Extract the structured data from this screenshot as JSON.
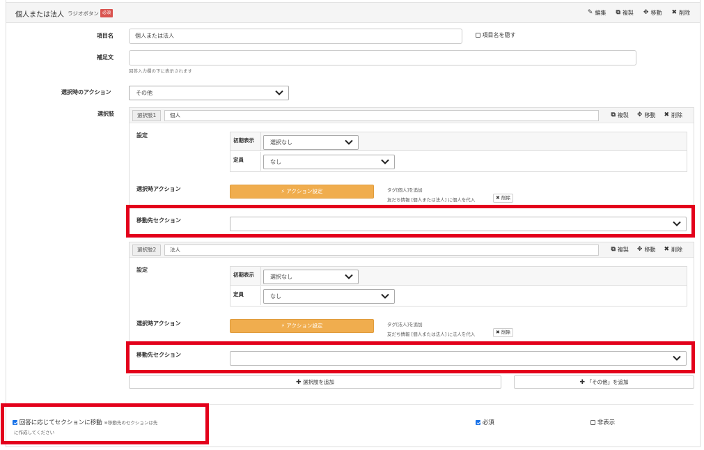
{
  "header": {
    "title": "個人または法人",
    "subtitle": "ラジオボタン",
    "required_badge": "必須",
    "actions": [
      {
        "icon": "pencil-icon",
        "label": "編集"
      },
      {
        "icon": "copy-icon",
        "label": "複製"
      },
      {
        "icon": "move-icon",
        "label": "移動"
      },
      {
        "icon": "close-icon",
        "label": "削除"
      }
    ]
  },
  "item_name": {
    "label": "項目名",
    "value": "個人または法人",
    "hide_label": "項目名を隠す"
  },
  "supplement": {
    "label": "補足文",
    "value": "",
    "hint": "回答入力欄の下に表示されます"
  },
  "select_action": {
    "label": "選択時のアクション",
    "value": "その他"
  },
  "choices_label": "選択肢",
  "choices": [
    {
      "tag": "選択肢1",
      "name": "個人",
      "actions": {
        "copy": "複製",
        "move": "移動",
        "delete": "削除"
      },
      "settings_label": "設定",
      "initial_display_label": "初期表示",
      "initial_display_value": "選択なし",
      "capacity_label": "定員",
      "capacity_value": "なし",
      "action_label": "選択時アクション",
      "action_button": "アクション設定",
      "note_tag": "タグ[個人]を追加",
      "note_friend": "友だち情報 [個人または法人] に個人を代入",
      "note_delete": "削除",
      "dest_label": "移動先セクション",
      "dest_value": ""
    },
    {
      "tag": "選択肢2",
      "name": "法人",
      "actions": {
        "copy": "複製",
        "move": "移動",
        "delete": "削除"
      },
      "settings_label": "設定",
      "initial_display_label": "初期表示",
      "initial_display_value": "選択なし",
      "capacity_label": "定員",
      "capacity_value": "なし",
      "action_label": "選択時アクション",
      "action_button": "アクション設定",
      "note_tag": "タグ[法人]を追加",
      "note_friend": "友だち情報 [個人または法人] に法人を代入",
      "note_delete": "削除",
      "dest_label": "移動先セクション",
      "dest_value": ""
    }
  ],
  "add_choice": "選択肢を追加",
  "add_other": "「その他」を追加",
  "footer": {
    "jump_label": "回答に応じてセクションに移動",
    "jump_note_1": "※移動先のセクションは先",
    "jump_note_2": "に作成してください",
    "jump_checked": true,
    "required_label": "必須",
    "required_checked": true,
    "hidden_label": "非表示",
    "hidden_checked": false
  },
  "colors": {
    "accent_orange": "#f0ad4e",
    "highlight_red": "#e3001b",
    "badge_red": "#d9534f",
    "check_blue": "#1a73e8"
  }
}
